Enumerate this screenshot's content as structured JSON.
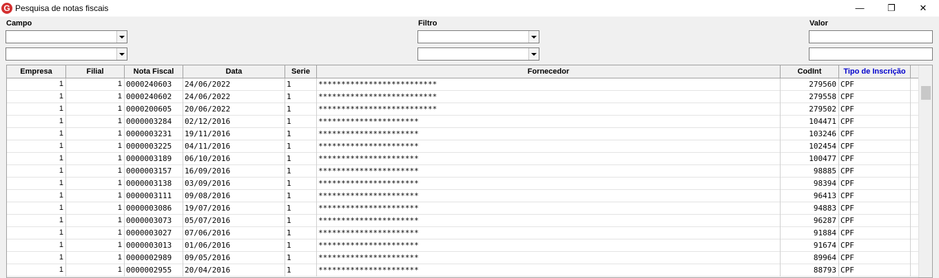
{
  "window": {
    "title": "Pesquisa de notas fiscais",
    "icon": "g-logo-icon",
    "minimize": "—",
    "maximize": "❐",
    "close": "✕"
  },
  "filters": {
    "campo_label": "Campo",
    "filtro_label": "Filtro",
    "valor_label": "Valor"
  },
  "table": {
    "columns": [
      "Empresa",
      "Filial",
      "Nota Fiscal",
      "Data",
      "Serie",
      "Fornecedor",
      "CodInt",
      "Tipo de Inscrição"
    ],
    "highlight_column_color": "#0000cc",
    "rows": [
      [
        "1",
        "1",
        "0000240603",
        "24/06/2022",
        "1",
        "**************************",
        "279560",
        "CPF"
      ],
      [
        "1",
        "1",
        "0000240602",
        "24/06/2022",
        "1",
        "**************************",
        "279558",
        "CPF"
      ],
      [
        "1",
        "1",
        "0000200605",
        "20/06/2022",
        "1",
        "**************************",
        "279502",
        "CPF"
      ],
      [
        "1",
        "1",
        "0000003284",
        "02/12/2016",
        "1",
        "**********************",
        "104471",
        "CPF"
      ],
      [
        "1",
        "1",
        "0000003231",
        "19/11/2016",
        "1",
        "**********************",
        "103246",
        "CPF"
      ],
      [
        "1",
        "1",
        "0000003225",
        "04/11/2016",
        "1",
        "**********************",
        "102454",
        "CPF"
      ],
      [
        "1",
        "1",
        "0000003189",
        "06/10/2016",
        "1",
        "**********************",
        "100477",
        "CPF"
      ],
      [
        "1",
        "1",
        "0000003157",
        "16/09/2016",
        "1",
        "**********************",
        "98885",
        "CPF"
      ],
      [
        "1",
        "1",
        "0000003138",
        "03/09/2016",
        "1",
        "**********************",
        "98394",
        "CPF"
      ],
      [
        "1",
        "1",
        "0000003111",
        "09/08/2016",
        "1",
        "**********************",
        "96413",
        "CPF"
      ],
      [
        "1",
        "1",
        "0000003086",
        "19/07/2016",
        "1",
        "**********************",
        "94883",
        "CPF"
      ],
      [
        "1",
        "1",
        "0000003073",
        "05/07/2016",
        "1",
        "**********************",
        "96287",
        "CPF"
      ],
      [
        "1",
        "1",
        "0000003027",
        "07/06/2016",
        "1",
        "**********************",
        "91884",
        "CPF"
      ],
      [
        "1",
        "1",
        "0000003013",
        "01/06/2016",
        "1",
        "**********************",
        "91674",
        "CPF"
      ],
      [
        "1",
        "1",
        "0000002989",
        "09/05/2016",
        "1",
        "**********************",
        "89964",
        "CPF"
      ],
      [
        "1",
        "1",
        "0000002955",
        "20/04/2016",
        "1",
        "**********************",
        "88793",
        "CPF"
      ]
    ]
  }
}
